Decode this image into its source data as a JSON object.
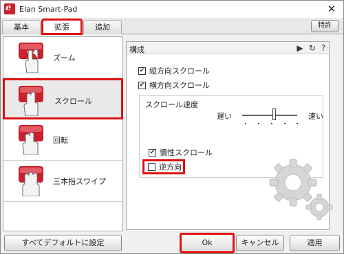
{
  "window": {
    "title": "Elan Smart-Pad",
    "close_glyph": "✕"
  },
  "tabs": [
    {
      "label": "基本"
    },
    {
      "label": "拡張"
    },
    {
      "label": "追加"
    }
  ],
  "special_button": "特許",
  "sidebar": {
    "items": [
      {
        "label": "ズーム",
        "icon": "zoom-gesture-icon"
      },
      {
        "label": "スクロール",
        "icon": "scroll-gesture-icon"
      },
      {
        "label": "回転",
        "icon": "rotate-gesture-icon"
      },
      {
        "label": "三本指スワイプ",
        "icon": "three-finger-swipe-icon"
      }
    ]
  },
  "panel": {
    "title": "構成",
    "header_icons": [
      "play-icon",
      "refresh-icon",
      "help-icon"
    ],
    "header_glyphs": {
      "play": "▶",
      "refresh": "↻",
      "help": "?"
    },
    "options": {
      "vertical_scroll": {
        "label": "縦方向スクロール",
        "checked": true
      },
      "horizontal_scroll": {
        "label": "横方向スクロール",
        "checked": true
      }
    },
    "speed_group": {
      "title": "スクロール速度",
      "slow_label": "遅い",
      "fast_label": "速い",
      "value": 0.55
    },
    "inertial_scroll": {
      "label": "慣性スクロール",
      "checked": true
    },
    "reverse": {
      "label": "逆方向",
      "checked": false
    }
  },
  "footer": {
    "reset_all": "すべてデフォルトに設定",
    "ok": "Ok",
    "cancel": "キャンセル",
    "apply": "適用"
  },
  "colors": {
    "brand": "#c8202c",
    "highlight": "#e01010"
  }
}
